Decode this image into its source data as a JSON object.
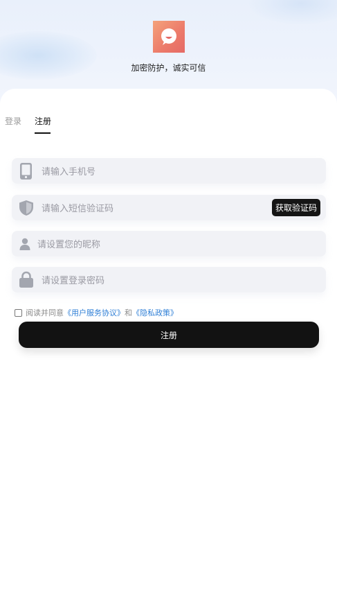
{
  "header": {
    "tagline": "加密防护，诚实可信"
  },
  "tabs": [
    {
      "label": "登录",
      "active": false
    },
    {
      "label": "注册",
      "active": true
    }
  ],
  "form": {
    "phone_placeholder": "请输入手机号",
    "sms_code_placeholder": "请输入短信验证码",
    "get_code_label": "获取验证码",
    "nickname_placeholder": "请设置您的昵称",
    "password_placeholder": "请设置登录密码"
  },
  "agreement": {
    "prefix": "阅读并同意",
    "user_agreement": "《用户服务协议》",
    "conjunction": "和",
    "privacy_policy": "《隐私政策》",
    "checked": false
  },
  "submit_label": "注册",
  "icons": {
    "logo": "chat-bubble-icon",
    "phone": "mobile-phone-icon",
    "sms_code": "shield-icon",
    "nickname": "user-icon",
    "password": "lock-icon"
  },
  "colors": {
    "accent": "#121212",
    "link": "#2f7fd6",
    "logo_start": "#f4a27a",
    "logo_end": "#e56a66"
  }
}
